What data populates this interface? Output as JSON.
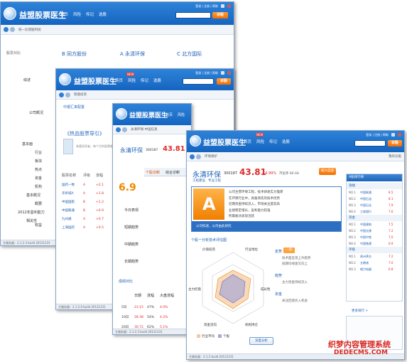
{
  "app": {
    "title": "益盟股票医生",
    "nav": [
      "首页",
      "风险",
      "传记",
      "选股"
    ],
    "new_tag": "NEW",
    "links": [
      "登录",
      "注册",
      "帮助"
    ],
    "search_button": "诊股"
  },
  "win1": {
    "breadcrumb": "统一比得股利润",
    "compare_label": "股票对比",
    "stocks": [
      "B 同方股份",
      "A 永清环保",
      "C 北方国际"
    ],
    "side_labels": [
      "综述",
      "公司概况",
      "基本面",
      "行业",
      "板块",
      "热点",
      "资金",
      "机构",
      "基本概况",
      "概要",
      "2012年盈利能力",
      "相关性",
      "权益"
    ],
    "status": "主服务器：2.1.2.3 build 20121231"
  },
  "win2": {
    "breadcrumb": "智能投资",
    "tab": "中银汇率配置",
    "headline": "《热血股票导引》",
    "para": "恭喜投资者，每个月的股票都有",
    "columns": [
      "股票名称",
      "评级",
      "涨幅"
    ],
    "rows": [
      {
        "name": "国药一致",
        "grade": "A",
        "chg": "+2.1"
      },
      {
        "name": "华侨城A",
        "grade": "A",
        "chg": "+1.8"
      },
      {
        "name": "中国国航",
        "grade": "B",
        "chg": "+1.2"
      },
      {
        "name": "中国联通",
        "grade": "B",
        "chg": "+0.9"
      },
      {
        "name": "九州通",
        "grade": "A",
        "chg": "+0.7"
      },
      {
        "name": "上海国药",
        "grade": "A",
        "chg": "+0.5"
      }
    ],
    "status": "主服务器：2.1.2.0 build 20121231"
  },
  "win3": {
    "breadcrumb": "永清环保-中国信息",
    "stock_name": "永清环保",
    "stock_code": "300187",
    "price": "43.81",
    "score": "6.9",
    "tabs": [
      "个股诊断",
      "综合诊断",
      "资金流向"
    ],
    "rows": [
      "今日表现",
      "短期趋势",
      "中期趋势",
      "长期趋势"
    ],
    "section": "成绩对比",
    "table_head": [
      "日期",
      "涨幅",
      "大盘涨幅"
    ],
    "table_rows": [
      {
        "date": "5日",
        "a": "23.15",
        "b": "47%",
        "c": "4.0%"
      },
      {
        "date": "10日",
        "a": "28.38",
        "b": "54%",
        "c": "4.2%"
      },
      {
        "date": "20日",
        "a": "30.72",
        "b": "62%",
        "c": "5.1%"
      }
    ],
    "status": "主服务器：2.1.2.3 build 20121231"
  },
  "win4": {
    "breadcrumb": "环境保护",
    "right_link": "我的诊股",
    "stock_name": "永清环保",
    "stock_code": "300187",
    "price": "43.81",
    "change": "+4.99%",
    "extra": "市盈率 86.68",
    "button": "加入自选",
    "sub_tabs": [
      "工程建设",
      "专业工程"
    ],
    "grade": "A",
    "summary_title": "公司综述，公司由此研究",
    "summary": [
      "公司主营环保工程，技术研发实力雄厚",
      "在环保行业中，具备领先的技术优势",
      "近期资金持续流入，市场关注度较高",
      "业绩稳定增长，盈利能力较强",
      "所属板块表现活跃"
    ],
    "radar_title": "个股一分析技术评估图",
    "radar_axes": [
      "价值投资",
      "行业地位",
      "成长性",
      "机构持仓",
      "资金流向",
      "主力控盘"
    ],
    "trend_labels": [
      "走势",
      "趋势",
      "资金"
    ],
    "trend_badge": "一般",
    "trend_text": [
      "技术面呈现上升趋势",
      "短期均线金叉向上",
      "主力资金持续流入",
      "关注回调买入机会"
    ],
    "legend": [
      "行业平均",
      "个股"
    ],
    "bottom_button": "深度分析",
    "status": "主服务器：2.1.2 build 20121231",
    "rank_title": "A股排行榜",
    "rank_groups": [
      {
        "name": "涨幅",
        "items": [
          [
            "NO.1",
            "中国联通",
            "8.5"
          ],
          [
            "NO.2",
            "中国石油",
            "8.1"
          ],
          [
            "NO.3",
            "中国石化",
            "7.9"
          ],
          [
            "NO.4",
            "工商银行",
            "7.6"
          ]
        ]
      },
      {
        "name": "资金",
        "items": [
          [
            "NO.1",
            "中国建筑",
            "7.5"
          ],
          [
            "NO.2",
            "中国交建",
            "7.2"
          ],
          [
            "NO.3",
            "中国中铁",
            "7.0"
          ],
          [
            "NO.4",
            "中国铁建",
            "6.9"
          ]
        ]
      },
      {
        "name": "评级",
        "items": [
          [
            "NO.1",
            "贵州茅台",
            "7.2"
          ],
          [
            "NO.2",
            "五粮液",
            "7.0"
          ],
          [
            "NO.3",
            "格力电器",
            "6.8"
          ]
        ]
      }
    ],
    "rank_more": "更多排行 >",
    "watermark_cn": "织梦内容管理系统",
    "watermark_en": "DEDECMS.COM"
  }
}
